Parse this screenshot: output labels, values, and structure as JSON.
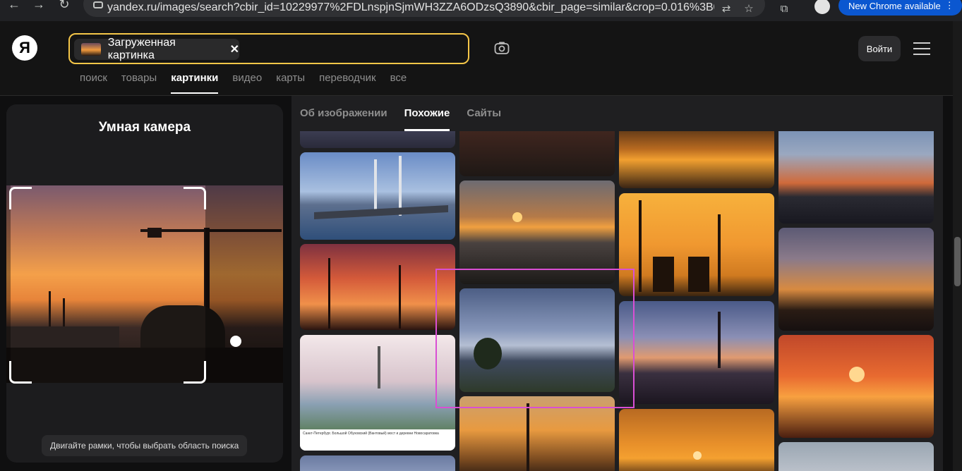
{
  "browser": {
    "url": "yandex.ru/images/search?cbir_id=10229977%2FDLnspjnSjmWH3ZZA6ODzsQ3890&cbir_page=similar&crop=0.016%3B0.016%3...",
    "update_label": "New Chrome available"
  },
  "header": {
    "logo": "Я",
    "search_chip_label": "Загруженная картинка",
    "login_label": "Войти",
    "tabs": [
      "поиск",
      "товары",
      "картинки",
      "видео",
      "карты",
      "переводчик",
      "все"
    ],
    "active_tab": "картинки"
  },
  "smart_camera": {
    "title": "Умная камера",
    "hint": "Двигайте рамки, чтобы выбрать область поиска"
  },
  "results": {
    "tabs": [
      "Об изображении",
      "Похожие",
      "Сайты"
    ],
    "active_tab": "Похожие",
    "caption_text": "Санкт-Петербург. Большой Обуховский (Вантовый) мост и деревни Новосаратовка"
  },
  "colors": {
    "accent_search_border": "#f5c648",
    "highlight_box": "#d94fd4",
    "chrome_update": "#0b57d0"
  }
}
